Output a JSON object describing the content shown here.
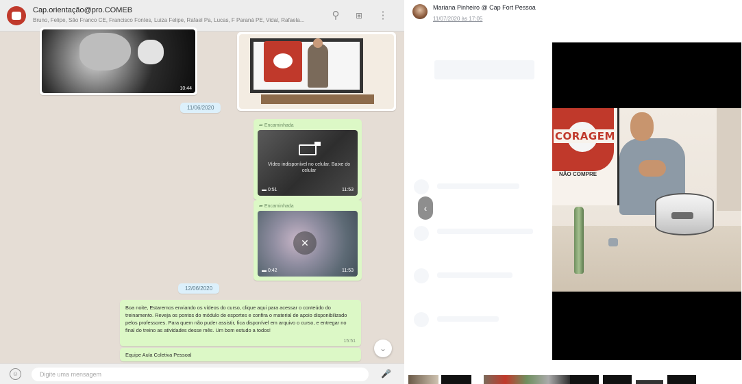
{
  "chat": {
    "header": {
      "group_name": "Cap.orientação@pro.COMEB",
      "members": "Bruno, Felipe, São Franco CE, Francisco Fontes, Luiza Felipe, Rafael Pa, Lucas, F Paraná PE, Vidal, Rafaela..."
    },
    "messages": {
      "image1_time": "10:44",
      "date_1": "11/06/2020",
      "forwarded_label": "Encaminhada",
      "video1_unavailable": "Vídeo indisponível no celular. Baixe do celular",
      "video1_duration": "0:51",
      "video1_time": "11:53",
      "video2_duration": "0:42",
      "video2_time": "11:53",
      "date_2": "12/06/2020",
      "text_body": "Boa noite, Estaremos enviando os vídeos do curso, clique aqui para acessar o conteúdo do treinamento. Reveja os pontos do módulo de esportes e confira o material de apoio disponibilizado pelos professores. Para quem não puder assistir, fica disponível em arquivo o curso, e entregar no final do treino as atividades desse mês. Um bom estudo a todos!",
      "text_time": "15:51",
      "signature": "Equipe Aula Coletiva Pessoal"
    },
    "composer": {
      "placeholder": "Digite uma mensagem"
    }
  },
  "viewer": {
    "poster_name": "Mariana Pinheiro @ Cap Fort Pessoa",
    "post_date": "11/07/2020 às 17:05",
    "video": {
      "banner_text": "CORAGEM",
      "banner_subtext": "NÃO COMPRE"
    }
  },
  "icons": {
    "search": "search-icon",
    "attach": "paperclip-icon",
    "menu": "kebab-menu-icon",
    "emoji": "emoji-icon",
    "mic": "mic-icon",
    "prev": "chevron-left-icon",
    "scroll": "chevron-down-icon"
  },
  "colors": {
    "chat_background": "#e5ddd5",
    "outgoing_bubble": "#dcf8c6",
    "date_pill": "#dcf0fb",
    "brand_red": "#c0392b"
  }
}
